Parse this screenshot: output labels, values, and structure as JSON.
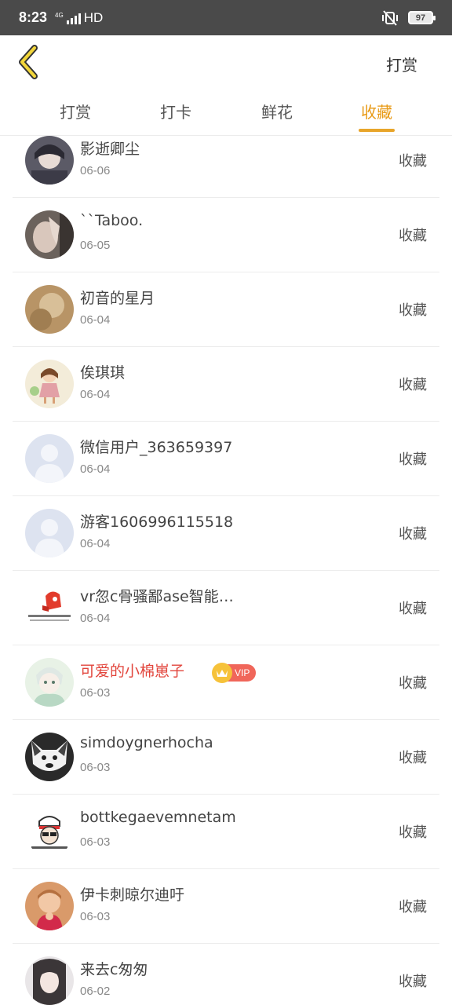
{
  "status_bar": {
    "time": "8:23",
    "network": "4G",
    "hd": "HD",
    "battery": "97"
  },
  "header": {
    "back_icon": "chevron-left-icon",
    "action_label": "打赏",
    "accent_color": "#e8a52a"
  },
  "tabs": [
    {
      "label": "打赏",
      "active": false
    },
    {
      "label": "打卡",
      "active": false
    },
    {
      "label": "鲜花",
      "active": false
    },
    {
      "label": "收藏",
      "active": true
    }
  ],
  "rows": [
    {
      "name": "影逝卿尘",
      "date": "06-06",
      "action": "收藏"
    },
    {
      "name": "``Taboo.",
      "date": "06-05",
      "action": "收藏"
    },
    {
      "name": "初音的星月",
      "date": "06-04",
      "action": "收藏"
    },
    {
      "name": "俟琪琪",
      "date": "06-04",
      "action": "收藏"
    },
    {
      "name": "微信用户_363659397",
      "date": "06-04",
      "action": "收藏"
    },
    {
      "name": "游客1606996115518",
      "date": "06-04",
      "action": "收藏"
    },
    {
      "name": "vr忽c骨骚鄙ase智能…",
      "date": "06-04",
      "action": "收藏"
    },
    {
      "name": "可爱的小棉崽子",
      "date": "06-03",
      "action": "收藏",
      "vip": "VIP"
    },
    {
      "name": "simdoygnerhocha",
      "date": "06-03",
      "action": "收藏"
    },
    {
      "name": "bottkegaevemnetam",
      "date": "06-03",
      "action": "收藏"
    },
    {
      "name": "伊卡刺晾尔迪吁",
      "date": "06-03",
      "action": "收藏"
    },
    {
      "name": "来去c匆匆",
      "date": "06-02",
      "action": "收藏"
    }
  ]
}
